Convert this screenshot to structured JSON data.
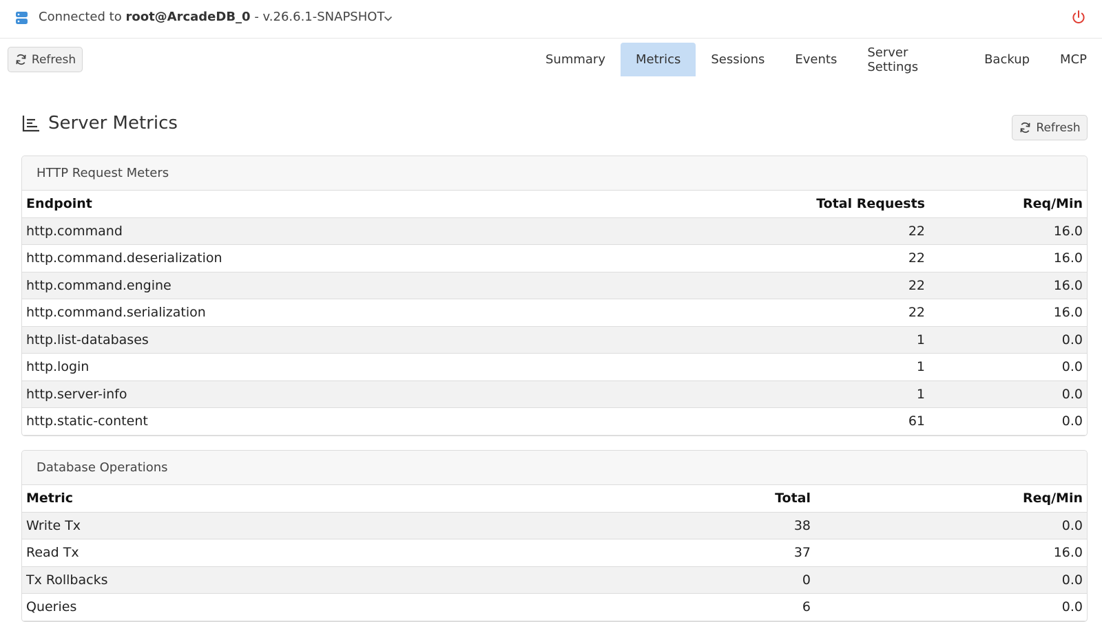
{
  "header": {
    "connection_prefix": "Connected to",
    "connection_target": "root@ArcadeDB_0",
    "connection_version": "- v.26.6.1-SNAPSHOT",
    "icon": "server-icon",
    "power_icon": "power-icon"
  },
  "toolbar": {
    "refresh_label": "Refresh",
    "tabs": [
      {
        "label": "Summary",
        "active": false
      },
      {
        "label": "Metrics",
        "active": true
      },
      {
        "label": "Sessions",
        "active": false
      },
      {
        "label": "Events",
        "active": false
      },
      {
        "label": "Server Settings",
        "active": false
      },
      {
        "label": "Backup",
        "active": false
      },
      {
        "label": "MCP",
        "active": false
      }
    ]
  },
  "main": {
    "title": "Server Metrics",
    "refresh_label": "Refresh",
    "http_meters": {
      "heading": "HTTP Request Meters",
      "columns": [
        "Endpoint",
        "Total Requests",
        "Req/Min"
      ],
      "rows": [
        [
          "http.command",
          "22",
          "16.0"
        ],
        [
          "http.command.deserialization",
          "22",
          "16.0"
        ],
        [
          "http.command.engine",
          "22",
          "16.0"
        ],
        [
          "http.command.serialization",
          "22",
          "16.0"
        ],
        [
          "http.list-databases",
          "1",
          "0.0"
        ],
        [
          "http.login",
          "1",
          "0.0"
        ],
        [
          "http.server-info",
          "1",
          "0.0"
        ],
        [
          "http.static-content",
          "61",
          "0.0"
        ]
      ]
    },
    "db_operations": {
      "heading": "Database Operations",
      "columns": [
        "Metric",
        "Total",
        "Req/Min"
      ],
      "rows": [
        [
          "Write Tx",
          "38",
          "0.0"
        ],
        [
          "Read Tx",
          "37",
          "16.0"
        ],
        [
          "Tx Rollbacks",
          "0",
          "0.0"
        ],
        [
          "Queries",
          "6",
          "0.0"
        ]
      ]
    }
  },
  "colors": {
    "accent": "#3f8fd8",
    "active_tab": "#c6ddf5",
    "power": "#e03c31"
  }
}
